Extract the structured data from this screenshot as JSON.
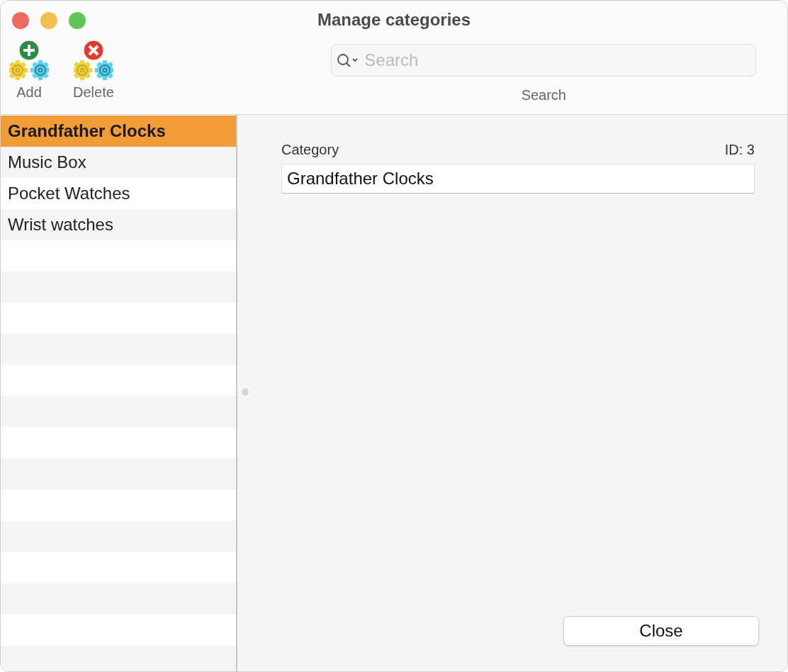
{
  "window": {
    "title": "Manage categories"
  },
  "toolbar": {
    "buttons": [
      {
        "kind": "add",
        "label": "Add"
      },
      {
        "kind": "delete",
        "label": "Delete"
      }
    ],
    "search": {
      "placeholder": "Search",
      "label": "Search"
    }
  },
  "categories": [
    {
      "name": "Grandfather Clocks",
      "selected": true
    },
    {
      "name": "Music Box",
      "selected": false
    },
    {
      "name": "Pocket Watches",
      "selected": false
    },
    {
      "name": "Wrist watches",
      "selected": false
    }
  ],
  "detail": {
    "label": "Category",
    "id": "ID: 3",
    "value": "Grandfather Clocks"
  },
  "buttons": {
    "close": "Close"
  }
}
